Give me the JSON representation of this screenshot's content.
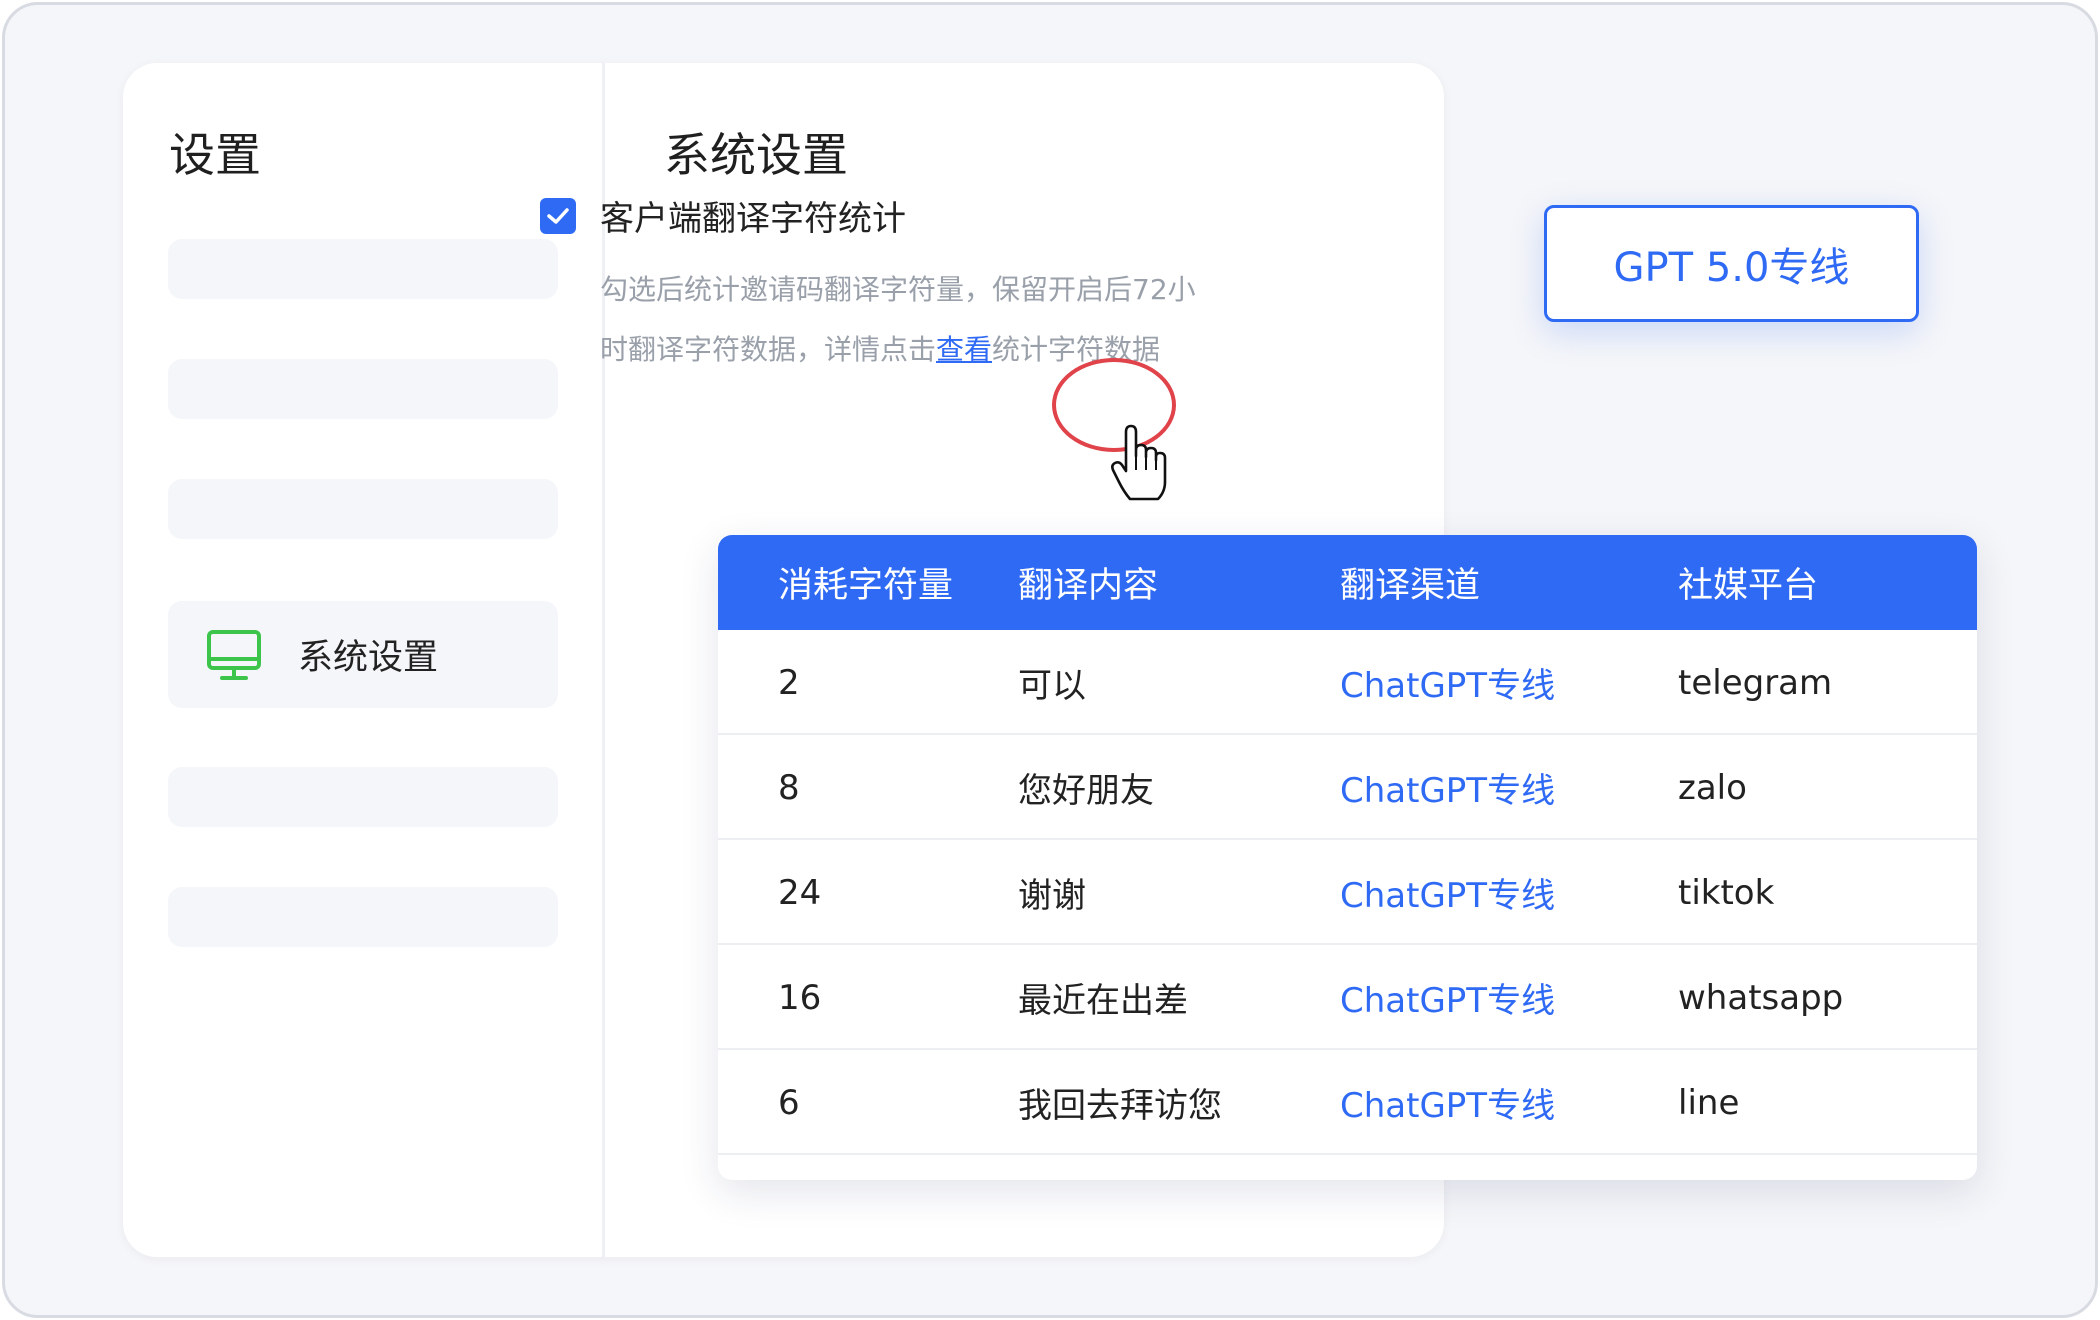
{
  "sidebar": {
    "title": "设置",
    "active_item": {
      "label": "系统设置",
      "icon": "monitor-icon"
    }
  },
  "main": {
    "title": "系统设置",
    "checkbox": {
      "label": "客户端翻译字符统计",
      "checked": true
    },
    "description": {
      "line1": "勾选后统计邀请码翻译字符量，保留开启后72小",
      "line2_before": "时翻译字符数据，详情点击",
      "link": "查看",
      "line2_after": "统计字符数据"
    }
  },
  "gpt_button": {
    "label": "GPT 5.0专线"
  },
  "table": {
    "columns": [
      "消耗字符量",
      "翻译内容",
      "翻译渠道",
      "社媒平台"
    ],
    "rows": [
      {
        "count": "2",
        "content": "可以",
        "channel": "ChatGPT专线",
        "platform": "telegram"
      },
      {
        "count": "8",
        "content": "您好朋友",
        "channel": "ChatGPT专线",
        "platform": "zalo"
      },
      {
        "count": "24",
        "content": "谢谢",
        "channel": "ChatGPT专线",
        "platform": "tiktok"
      },
      {
        "count": "16",
        "content": "最近在出差",
        "channel": "ChatGPT专线",
        "platform": "whatsapp"
      },
      {
        "count": "6",
        "content": "我回去拜访您",
        "channel": "ChatGPT专线",
        "platform": "line"
      }
    ]
  },
  "colors": {
    "accent": "#2f6af5",
    "highlight": "#e0434a",
    "monitor_icon": "#3cc44b",
    "placeholder_bar": "#f4f6fa"
  }
}
